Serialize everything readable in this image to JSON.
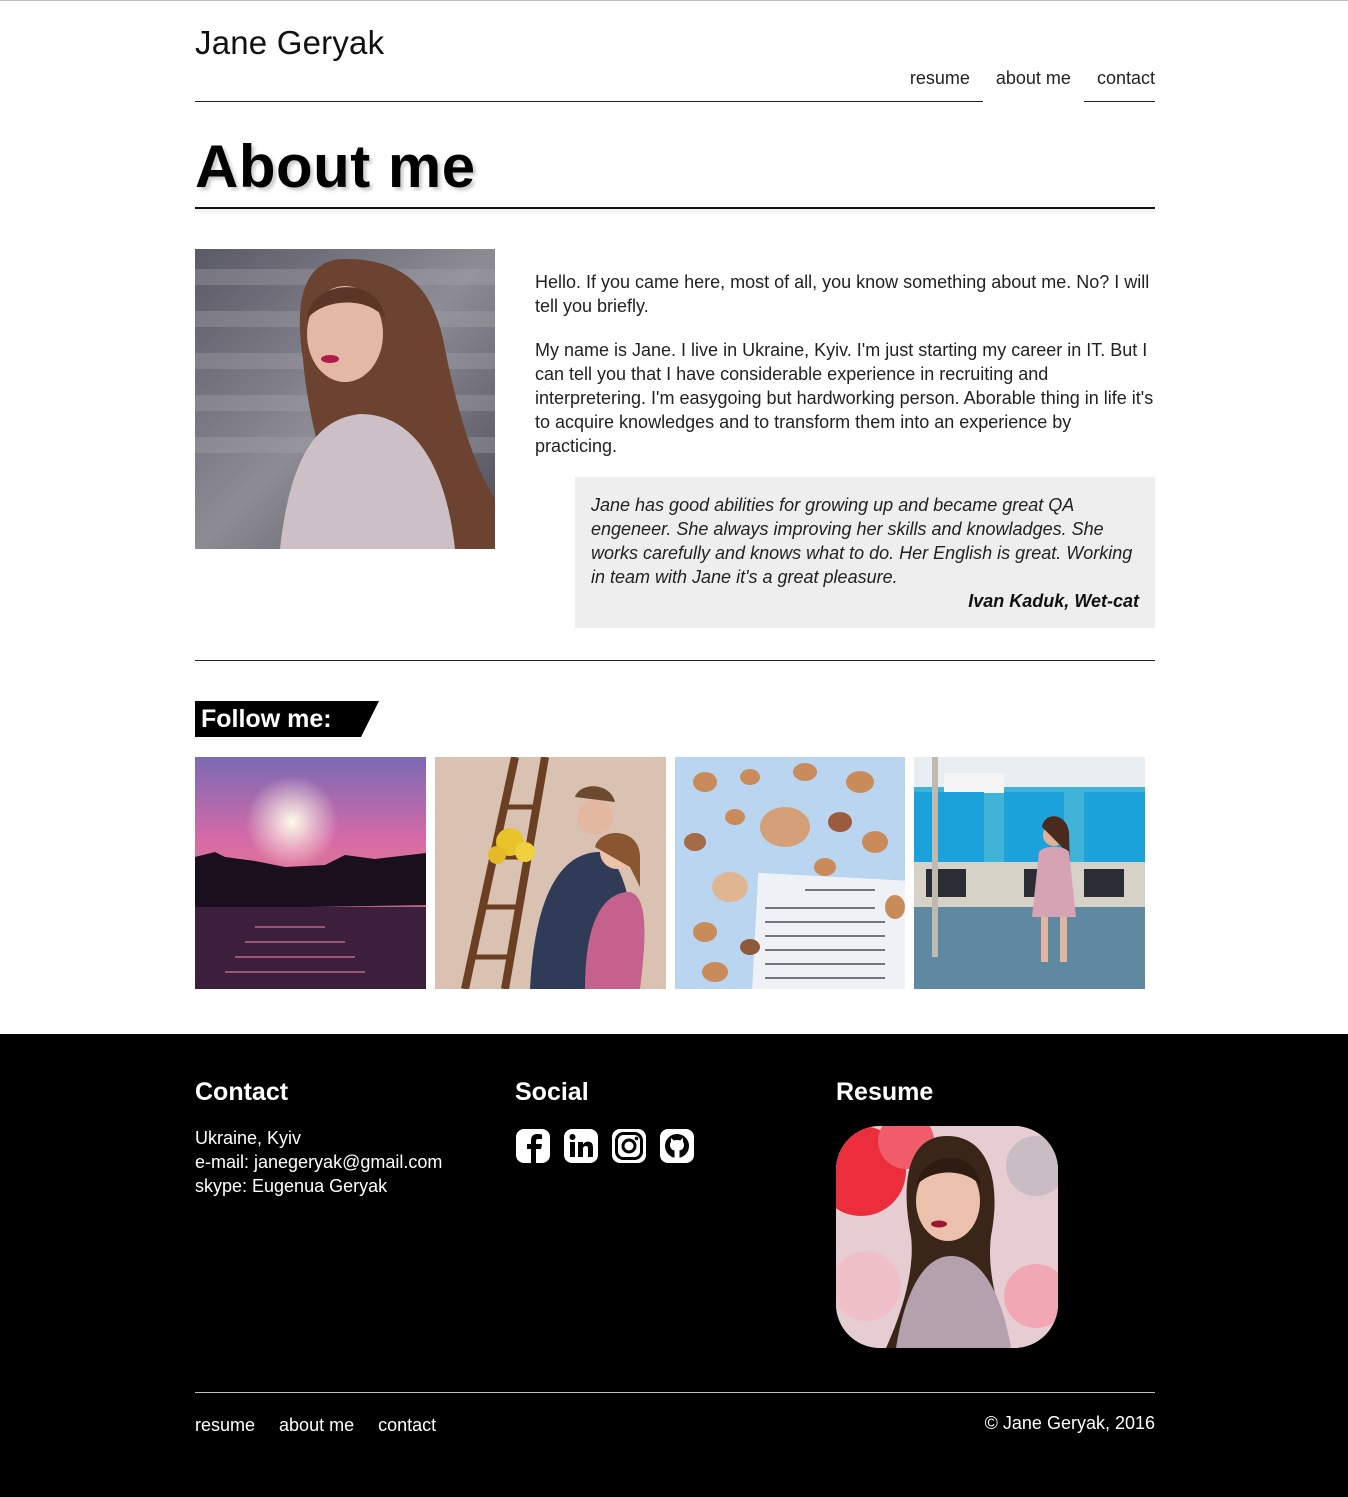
{
  "header": {
    "site_title": "Jane Geryak",
    "nav": [
      {
        "label": "resume"
      },
      {
        "label": "about me"
      },
      {
        "label": "contact"
      }
    ]
  },
  "main": {
    "page_title": "About me",
    "bio": [
      "Hello. If you came here, most of all, you know something about me. No? I will tell you briefly.",
      "My name is Jane. I live in Ukraine, Kyiv. I'm just starting my career in IT. But I can tell you that I have considerable experience in recruiting and interpretering. I'm easygoing but hardworking person. Aborable thing in life it's to acquire knowledges and to transform them into an experience by practicing."
    ],
    "quote": {
      "text": "Jane has good abilities for growing up and became great QA engeneer. She always improving her skills and knowladges. She works carefully and knows what to do. Her English is great. Working in team with Jane it's a great pleasure.",
      "author": "Ivan Kaduk, Wet-cat"
    },
    "follow_label": "Follow me:"
  },
  "footer": {
    "contact": {
      "heading": "Contact",
      "location": "Ukraine, Kyiv",
      "email": "e-mail: janegeryak@gmail.com",
      "skype": "skype: Eugenua Geryak"
    },
    "social": {
      "heading": "Social",
      "icons": [
        "facebook-icon",
        "linkedin-icon",
        "instagram-icon",
        "github-icon"
      ]
    },
    "resume": {
      "heading": "Resume"
    },
    "nav": [
      {
        "label": "resume"
      },
      {
        "label": "about me"
      },
      {
        "label": "contact"
      }
    ],
    "copyright": "© Jane Geryak, 2016"
  },
  "colors": {
    "quote_bg": "#eeeeee",
    "footer_bg": "#000000",
    "text": "#222222"
  }
}
